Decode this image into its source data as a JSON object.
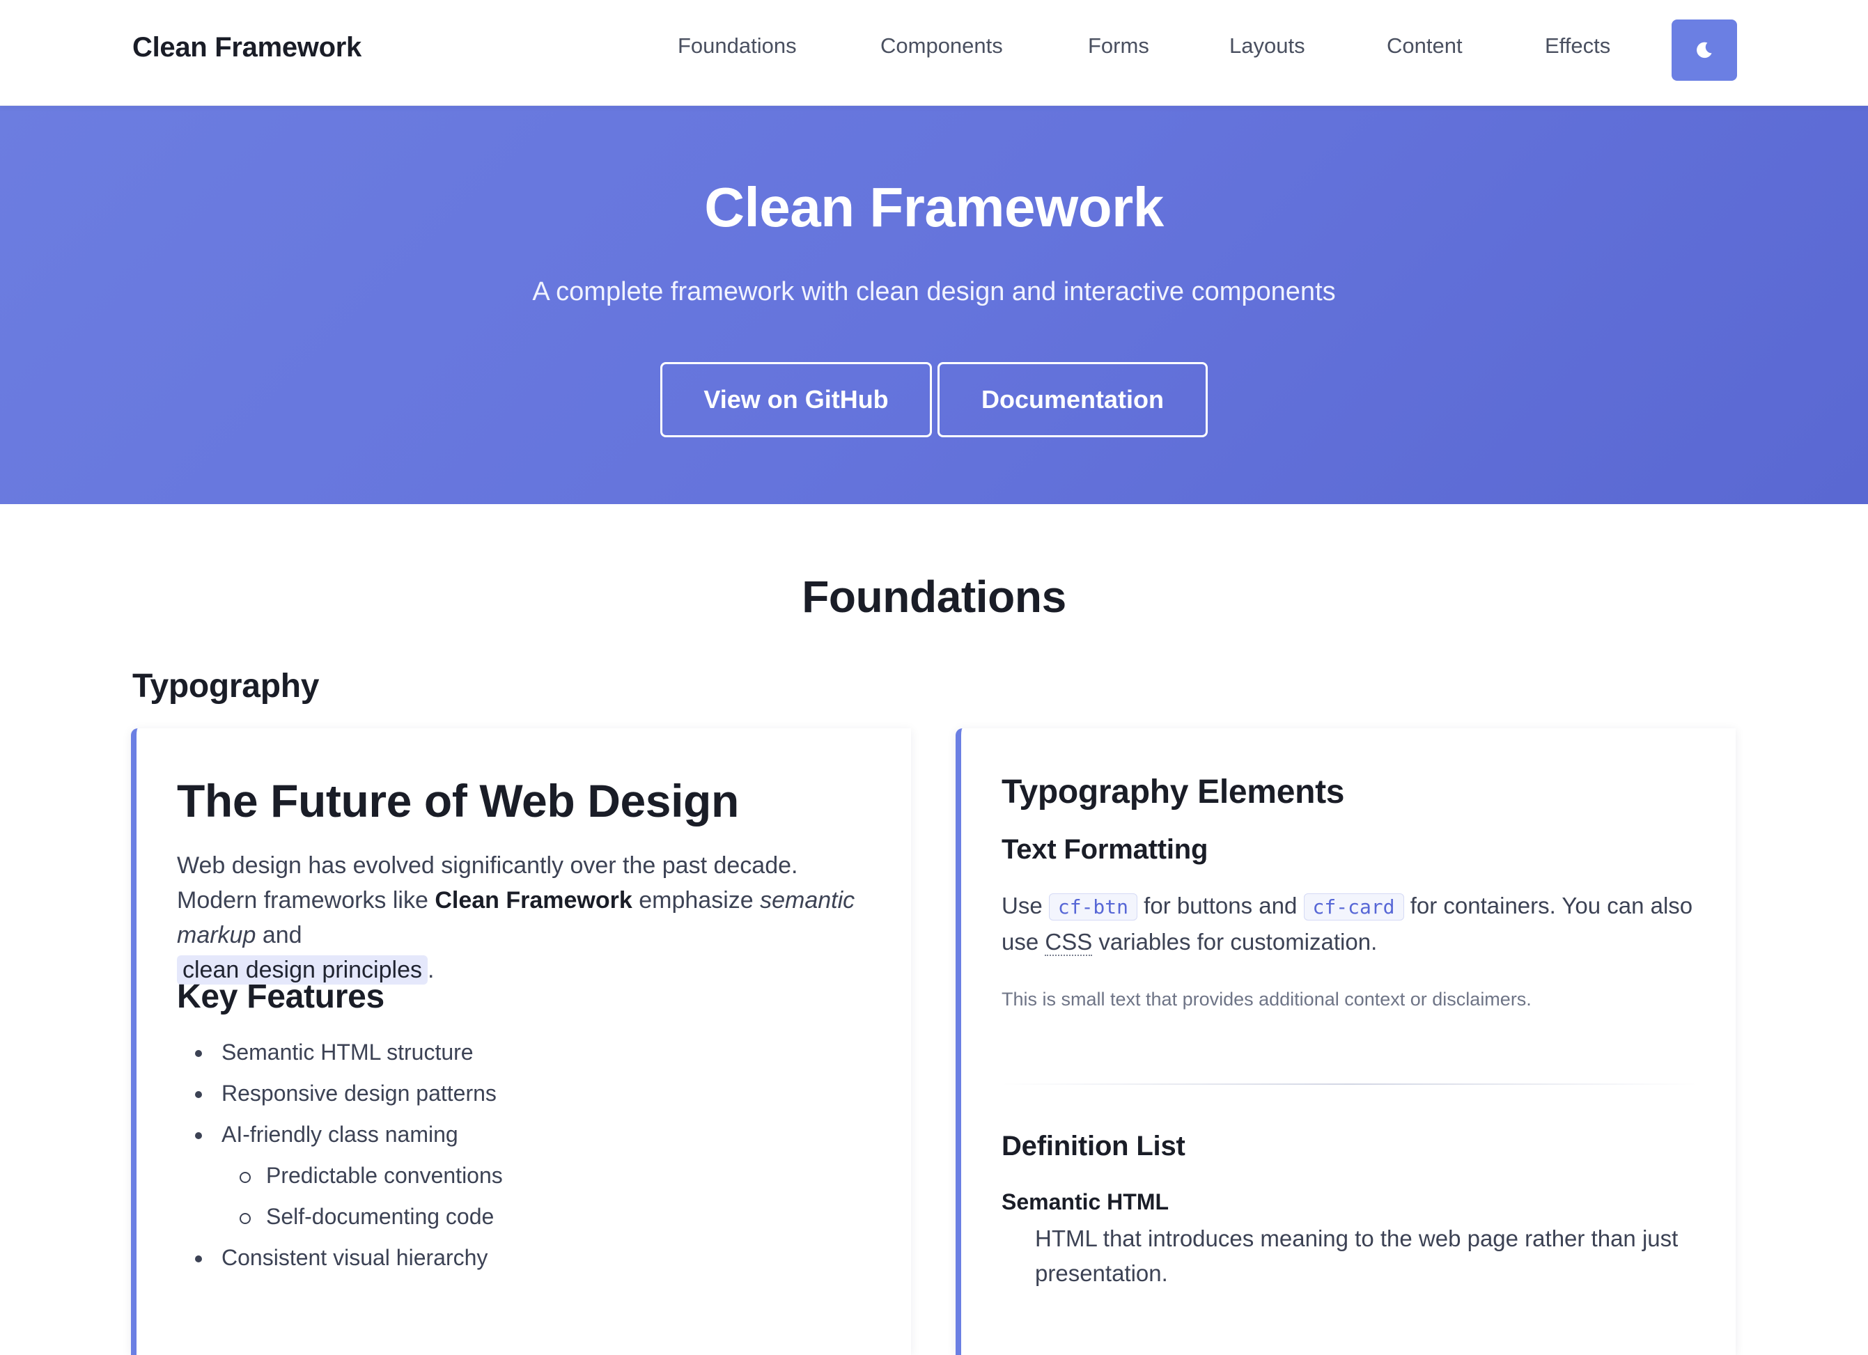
{
  "navbar": {
    "brand": "Clean Framework",
    "links": [
      "Foundations",
      "Components",
      "Forms",
      "Layouts",
      "Content",
      "Effects"
    ],
    "theme_toggle_icon": "moon-icon"
  },
  "hero": {
    "title": "Clean Framework",
    "subtitle": "A complete framework with clean design and interactive components",
    "buttons": [
      "View on GitHub",
      "Documentation"
    ]
  },
  "foundations": {
    "title": "Foundations",
    "typography_title": "Typography",
    "left_card": {
      "heading": "The Future of Web Design",
      "para_1": "Web design has evolved significantly over the past decade. Modern frameworks like ",
      "para_bold": "Clean Framework",
      "para_2": " emphasize ",
      "para_em": "semantic markup",
      "para_3": " and ",
      "para_mark": "clean design principles",
      "para_4": ".",
      "features_title": "Key Features",
      "features": [
        "Semantic HTML structure",
        "Responsive design patterns",
        "AI-friendly class naming",
        "Predictable conventions",
        "Self-documenting code",
        "Consistent visual hierarchy"
      ]
    },
    "right_card": {
      "heading": "Typography Elements",
      "text_formatting_title": "Text Formatting",
      "tf_1": "Use ",
      "tf_code_1": "cf-btn",
      "tf_2": " for buttons and ",
      "tf_code_2": "cf-card",
      "tf_3": " for containers. You can also use ",
      "tf_abbr": "CSS",
      "tf_4": " variables for customization.",
      "small_text": "This is small text that provides additional context or disclaimers.",
      "definition_list_title": "Definition List",
      "dt": "Semantic HTML",
      "dd": "HTML that introduces meaning to the web page rather than just presentation."
    }
  },
  "colors": {
    "accent": "#6b7fe3",
    "hero_gradient_start": "#6c7de0",
    "hero_gradient_end": "#5a68d2"
  }
}
